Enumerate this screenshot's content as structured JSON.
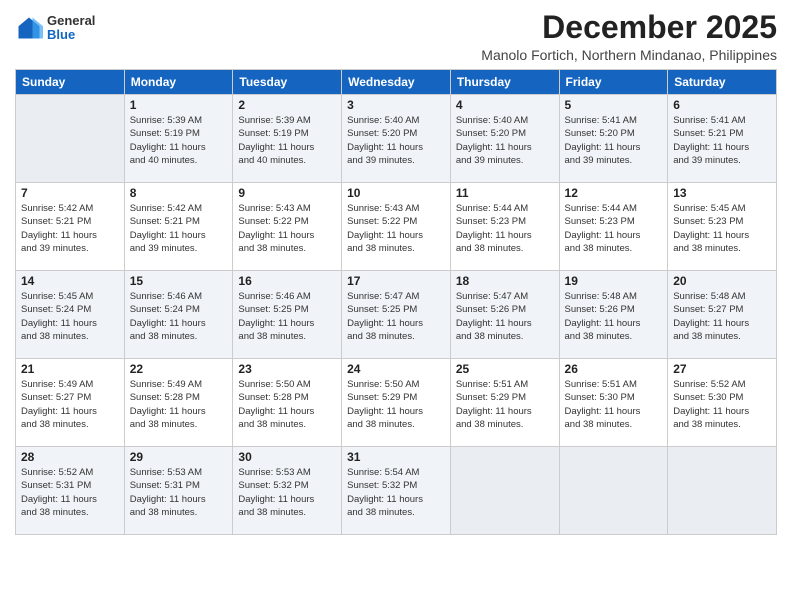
{
  "header": {
    "logo": {
      "general": "General",
      "blue": "Blue"
    },
    "month": "December 2025",
    "location": "Manolo Fortich, Northern Mindanao, Philippines"
  },
  "weekdays": [
    "Sunday",
    "Monday",
    "Tuesday",
    "Wednesday",
    "Thursday",
    "Friday",
    "Saturday"
  ],
  "weeks": [
    [
      {
        "day": "",
        "sunrise": "",
        "sunset": "",
        "daylight": ""
      },
      {
        "day": "1",
        "sunrise": "Sunrise: 5:39 AM",
        "sunset": "Sunset: 5:19 PM",
        "daylight": "Daylight: 11 hours and 40 minutes."
      },
      {
        "day": "2",
        "sunrise": "Sunrise: 5:39 AM",
        "sunset": "Sunset: 5:19 PM",
        "daylight": "Daylight: 11 hours and 40 minutes."
      },
      {
        "day": "3",
        "sunrise": "Sunrise: 5:40 AM",
        "sunset": "Sunset: 5:20 PM",
        "daylight": "Daylight: 11 hours and 39 minutes."
      },
      {
        "day": "4",
        "sunrise": "Sunrise: 5:40 AM",
        "sunset": "Sunset: 5:20 PM",
        "daylight": "Daylight: 11 hours and 39 minutes."
      },
      {
        "day": "5",
        "sunrise": "Sunrise: 5:41 AM",
        "sunset": "Sunset: 5:20 PM",
        "daylight": "Daylight: 11 hours and 39 minutes."
      },
      {
        "day": "6",
        "sunrise": "Sunrise: 5:41 AM",
        "sunset": "Sunset: 5:21 PM",
        "daylight": "Daylight: 11 hours and 39 minutes."
      }
    ],
    [
      {
        "day": "7",
        "sunrise": "Sunrise: 5:42 AM",
        "sunset": "Sunset: 5:21 PM",
        "daylight": "Daylight: 11 hours and 39 minutes."
      },
      {
        "day": "8",
        "sunrise": "Sunrise: 5:42 AM",
        "sunset": "Sunset: 5:21 PM",
        "daylight": "Daylight: 11 hours and 39 minutes."
      },
      {
        "day": "9",
        "sunrise": "Sunrise: 5:43 AM",
        "sunset": "Sunset: 5:22 PM",
        "daylight": "Daylight: 11 hours and 38 minutes."
      },
      {
        "day": "10",
        "sunrise": "Sunrise: 5:43 AM",
        "sunset": "Sunset: 5:22 PM",
        "daylight": "Daylight: 11 hours and 38 minutes."
      },
      {
        "day": "11",
        "sunrise": "Sunrise: 5:44 AM",
        "sunset": "Sunset: 5:23 PM",
        "daylight": "Daylight: 11 hours and 38 minutes."
      },
      {
        "day": "12",
        "sunrise": "Sunrise: 5:44 AM",
        "sunset": "Sunset: 5:23 PM",
        "daylight": "Daylight: 11 hours and 38 minutes."
      },
      {
        "day": "13",
        "sunrise": "Sunrise: 5:45 AM",
        "sunset": "Sunset: 5:23 PM",
        "daylight": "Daylight: 11 hours and 38 minutes."
      }
    ],
    [
      {
        "day": "14",
        "sunrise": "Sunrise: 5:45 AM",
        "sunset": "Sunset: 5:24 PM",
        "daylight": "Daylight: 11 hours and 38 minutes."
      },
      {
        "day": "15",
        "sunrise": "Sunrise: 5:46 AM",
        "sunset": "Sunset: 5:24 PM",
        "daylight": "Daylight: 11 hours and 38 minutes."
      },
      {
        "day": "16",
        "sunrise": "Sunrise: 5:46 AM",
        "sunset": "Sunset: 5:25 PM",
        "daylight": "Daylight: 11 hours and 38 minutes."
      },
      {
        "day": "17",
        "sunrise": "Sunrise: 5:47 AM",
        "sunset": "Sunset: 5:25 PM",
        "daylight": "Daylight: 11 hours and 38 minutes."
      },
      {
        "day": "18",
        "sunrise": "Sunrise: 5:47 AM",
        "sunset": "Sunset: 5:26 PM",
        "daylight": "Daylight: 11 hours and 38 minutes."
      },
      {
        "day": "19",
        "sunrise": "Sunrise: 5:48 AM",
        "sunset": "Sunset: 5:26 PM",
        "daylight": "Daylight: 11 hours and 38 minutes."
      },
      {
        "day": "20",
        "sunrise": "Sunrise: 5:48 AM",
        "sunset": "Sunset: 5:27 PM",
        "daylight": "Daylight: 11 hours and 38 minutes."
      }
    ],
    [
      {
        "day": "21",
        "sunrise": "Sunrise: 5:49 AM",
        "sunset": "Sunset: 5:27 PM",
        "daylight": "Daylight: 11 hours and 38 minutes."
      },
      {
        "day": "22",
        "sunrise": "Sunrise: 5:49 AM",
        "sunset": "Sunset: 5:28 PM",
        "daylight": "Daylight: 11 hours and 38 minutes."
      },
      {
        "day": "23",
        "sunrise": "Sunrise: 5:50 AM",
        "sunset": "Sunset: 5:28 PM",
        "daylight": "Daylight: 11 hours and 38 minutes."
      },
      {
        "day": "24",
        "sunrise": "Sunrise: 5:50 AM",
        "sunset": "Sunset: 5:29 PM",
        "daylight": "Daylight: 11 hours and 38 minutes."
      },
      {
        "day": "25",
        "sunrise": "Sunrise: 5:51 AM",
        "sunset": "Sunset: 5:29 PM",
        "daylight": "Daylight: 11 hours and 38 minutes."
      },
      {
        "day": "26",
        "sunrise": "Sunrise: 5:51 AM",
        "sunset": "Sunset: 5:30 PM",
        "daylight": "Daylight: 11 hours and 38 minutes."
      },
      {
        "day": "27",
        "sunrise": "Sunrise: 5:52 AM",
        "sunset": "Sunset: 5:30 PM",
        "daylight": "Daylight: 11 hours and 38 minutes."
      }
    ],
    [
      {
        "day": "28",
        "sunrise": "Sunrise: 5:52 AM",
        "sunset": "Sunset: 5:31 PM",
        "daylight": "Daylight: 11 hours and 38 minutes."
      },
      {
        "day": "29",
        "sunrise": "Sunrise: 5:53 AM",
        "sunset": "Sunset: 5:31 PM",
        "daylight": "Daylight: 11 hours and 38 minutes."
      },
      {
        "day": "30",
        "sunrise": "Sunrise: 5:53 AM",
        "sunset": "Sunset: 5:32 PM",
        "daylight": "Daylight: 11 hours and 38 minutes."
      },
      {
        "day": "31",
        "sunrise": "Sunrise: 5:54 AM",
        "sunset": "Sunset: 5:32 PM",
        "daylight": "Daylight: 11 hours and 38 minutes."
      },
      {
        "day": "",
        "sunrise": "",
        "sunset": "",
        "daylight": ""
      },
      {
        "day": "",
        "sunrise": "",
        "sunset": "",
        "daylight": ""
      },
      {
        "day": "",
        "sunrise": "",
        "sunset": "",
        "daylight": ""
      }
    ]
  ]
}
